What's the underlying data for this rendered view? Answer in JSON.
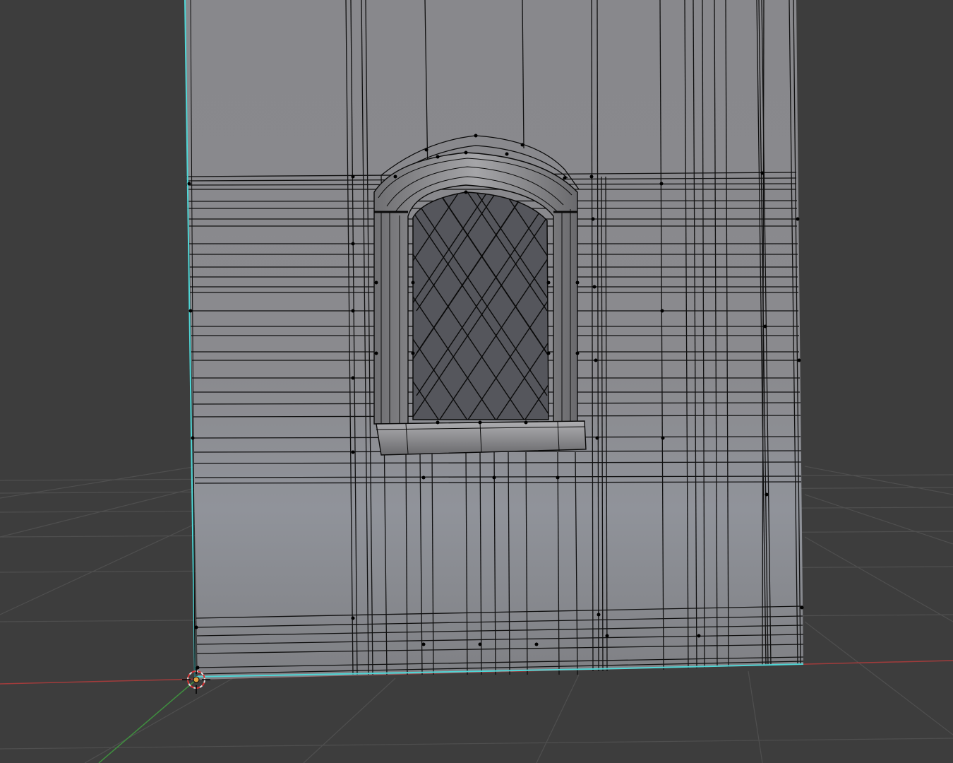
{
  "viewport": {
    "mode": "3d-edit-mode",
    "background_color": "#3d3d3d",
    "grid_color": "#4f4f4f",
    "x_axis_color": "#a23c3c",
    "y_axis_color": "#3f8f3f",
    "mesh_face_color": "#8a8a8e",
    "mesh_edge_color": "#000000",
    "boundary_edge_color": "#4fd6d6",
    "window_glass_color": "#55565c",
    "cursor_icon": "3d-cursor-icon",
    "origin_icon": "object-origin-icon"
  }
}
